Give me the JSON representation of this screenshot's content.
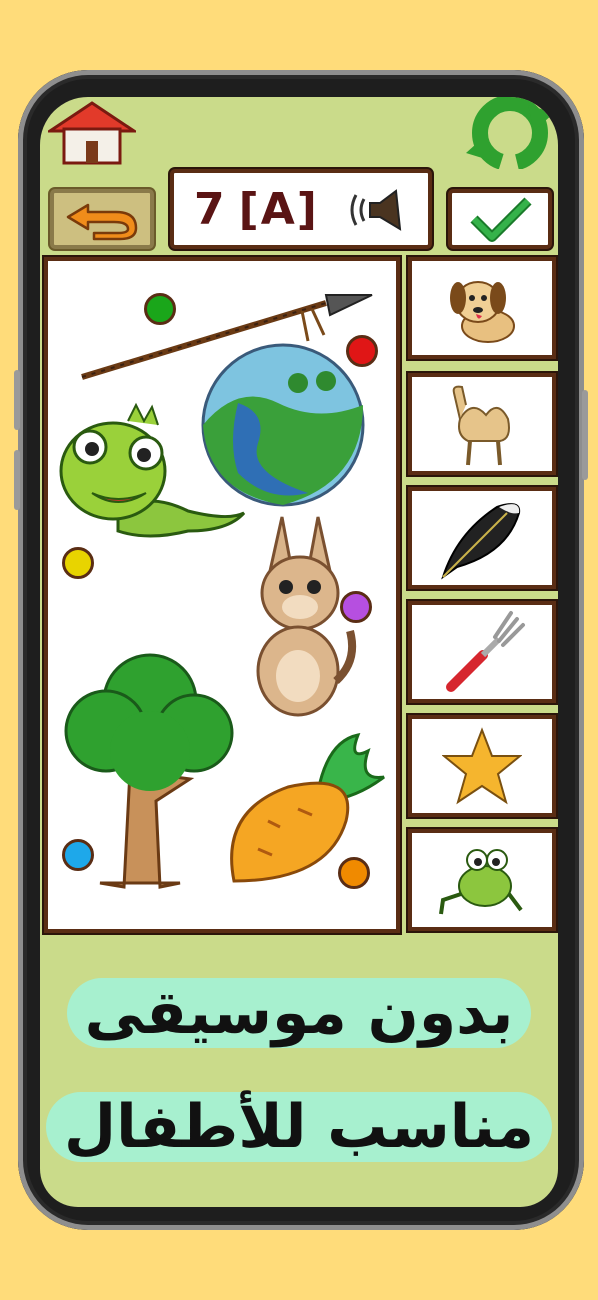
{
  "word_prompt": {
    "number": "7",
    "letter": "[A]"
  },
  "dots": {
    "green": "#1aa61a",
    "red": "#e01616",
    "yellow": "#e8d400",
    "purple": "#b64fe0",
    "blue": "#1ea8ea",
    "orange": "#f08a00"
  },
  "board_items": [
    "spear",
    "earth",
    "iguana",
    "kangaroo",
    "tree",
    "carrot"
  ],
  "choices": [
    "dog",
    "camel",
    "feather",
    "fork",
    "star",
    "frog"
  ],
  "caption": {
    "line1": "بدون موسيقى",
    "line2": "مناسب للأطفال"
  },
  "colors": {
    "page_bg": "#FFDC7A",
    "screen_bg": "#CADB8A",
    "frame": "#5a2d14",
    "caption_highlight": "#a7f0cf"
  }
}
